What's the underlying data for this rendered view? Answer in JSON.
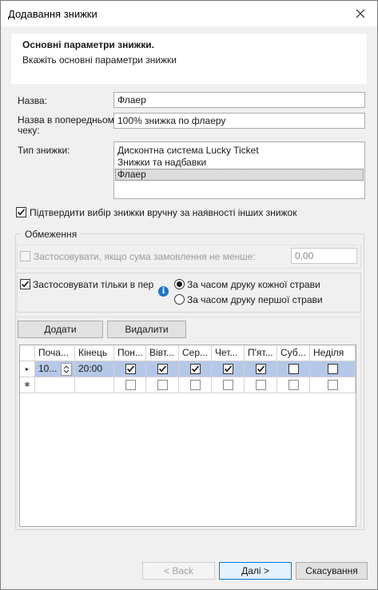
{
  "window": {
    "title": "Додавання знижки"
  },
  "header": {
    "title": "Основні параметри знижки.",
    "subtitle": "Вкажіть основні параметри знижки"
  },
  "form": {
    "name_label": "Назва:",
    "name_value": "Флаер",
    "receipt_label_line1": "Назва в попередньому",
    "receipt_label_line2": "чеку:",
    "receipt_value": "100% знижка по флаеру",
    "type_label": "Тип знижки:",
    "type_options": [
      {
        "label": "Дисконтна система Lucky Ticket",
        "selected": false
      },
      {
        "label": "Знижки та надбавки",
        "selected": false
      },
      {
        "label": "Флаер",
        "selected": true
      }
    ],
    "confirm_checkbox_label": "Підтвердити вибір знижки вручну за наявності інших знижок",
    "confirm_checked": true
  },
  "restrictions": {
    "group_label": "Обмеження",
    "min_sum_label": "Застосовувати, якщо сума замовлення не менше:",
    "min_sum_checked": false,
    "min_sum_value": "0,00",
    "period_label": "Застосовувати тільки в період",
    "period_checked": true,
    "radio_each": "За часом друку кожної страви",
    "radio_first": "За часом друку першої страви",
    "radio_selected": "each"
  },
  "grid_toolbar": {
    "add_label": "Додати",
    "delete_label": "Видалити"
  },
  "grid": {
    "columns": [
      "Поча...",
      "Кінець",
      "Пон...",
      "Вівт...",
      "Сер...",
      "Чет...",
      "П'ят...",
      "Суб...",
      "Неділя"
    ],
    "rows": [
      {
        "marker": "▸",
        "start": "10...",
        "end": "20:00",
        "days": [
          true,
          true,
          true,
          true,
          true,
          false,
          false
        ]
      },
      {
        "marker": "✱",
        "start": "",
        "end": "",
        "days": [
          false,
          false,
          false,
          false,
          false,
          false,
          false
        ]
      }
    ]
  },
  "footer": {
    "back_label": "< Back",
    "next_label": "Далі >",
    "cancel_label": "Скасування"
  },
  "colors": {
    "selected_row": "#b5c8e8",
    "primary_border": "#0078d7",
    "info_icon": "#1e72c8"
  }
}
